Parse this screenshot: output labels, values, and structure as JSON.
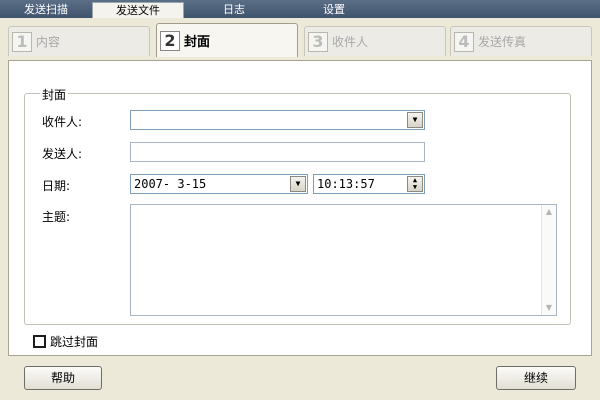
{
  "top_tabs": [
    {
      "label": "发送扫描",
      "active": false
    },
    {
      "label": "发送文件",
      "active": true
    },
    {
      "label": "日志",
      "active": false
    },
    {
      "label": "设置",
      "active": false
    }
  ],
  "steps": [
    {
      "number": "1",
      "label": "内容",
      "active": false
    },
    {
      "number": "2",
      "label": "封面",
      "active": true
    },
    {
      "number": "3",
      "label": "收件人",
      "active": false
    },
    {
      "number": "4",
      "label": "发送传真",
      "active": false
    }
  ],
  "cover_group": {
    "legend": "封面",
    "recipient_label": "收件人:",
    "recipient_value": "",
    "sender_label": "发送人:",
    "sender_value": "",
    "date_label": "日期:",
    "date_value": "2007- 3-15",
    "time_value": "10:13:57",
    "subject_label": "主题:",
    "subject_value": ""
  },
  "skip_cover": {
    "label": "跳过封面",
    "checked": false
  },
  "buttons": {
    "help": "帮助",
    "continue": "继续"
  },
  "icons": {
    "combo_arrow": "▼",
    "spin_up": "▲",
    "spin_down": "▼",
    "scroll_up": "▲",
    "scroll_down": "▼"
  },
  "colors": {
    "topbar": "#4a5f78",
    "panel_bg": "#ffffff",
    "frame_bg": "#ece9d8"
  }
}
